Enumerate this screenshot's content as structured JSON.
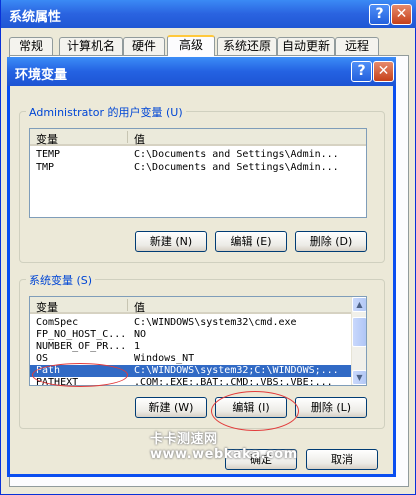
{
  "outer_dialog": {
    "title": "系统属性",
    "help_label": "?",
    "close_label": "✕",
    "tabs": [
      {
        "label": "常规"
      },
      {
        "label": "计算机名"
      },
      {
        "label": "硬件"
      },
      {
        "label": "高级"
      },
      {
        "label": "系统还原"
      },
      {
        "label": "自动更新"
      },
      {
        "label": "远程"
      }
    ],
    "active_tab": "高级"
  },
  "env_dialog": {
    "title": "环境变量",
    "help_label": "?",
    "close_label": "✕",
    "user_vars": {
      "legend": "Administrator 的用户变量 (U)",
      "columns": [
        "变量",
        "值"
      ],
      "rows": [
        {
          "name": "TEMP",
          "value": "C:\\Documents and Settings\\Admin..."
        },
        {
          "name": "TMP",
          "value": "C:\\Documents and Settings\\Admin..."
        }
      ],
      "buttons": {
        "new": "新建 (N)",
        "edit": "编辑 (E)",
        "delete": "删除 (D)"
      }
    },
    "system_vars": {
      "legend": "系统变量 (S)",
      "columns": [
        "变量",
        "值"
      ],
      "rows": [
        {
          "name": "ComSpec",
          "value": "C:\\WINDOWS\\system32\\cmd.exe"
        },
        {
          "name": "FP_NO_HOST_C...",
          "value": "NO"
        },
        {
          "name": "NUMBER_OF_PR...",
          "value": "1"
        },
        {
          "name": "OS",
          "value": "Windows_NT"
        },
        {
          "name": "Path",
          "value": "C:\\WINDOWS\\system32;C:\\WINDOWS;..."
        },
        {
          "name": "PATHEXT",
          "value": ".COM;.EXE;.BAT;.CMD;.VBS;.VBE;..."
        }
      ],
      "selected_row": "Path",
      "buttons": {
        "new": "新建 (W)",
        "edit": "编辑 (I)",
        "delete": "删除 (L)"
      }
    },
    "ok_label": "确定",
    "cancel_label": "取消"
  },
  "watermark": "卡卡测速网 www.webkaka.com",
  "colors": {
    "title_bar": "#2a63e0",
    "selection": "#316ac5",
    "annotation": "#e23b3b",
    "group_legend": "#0046d5"
  }
}
